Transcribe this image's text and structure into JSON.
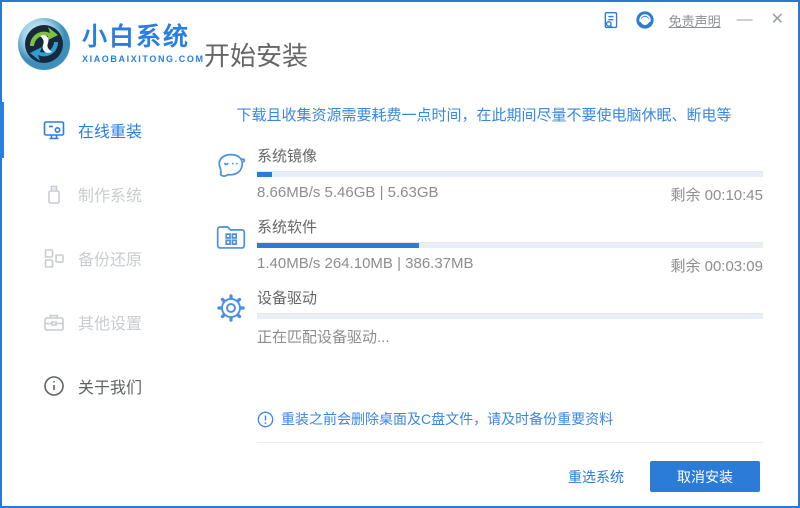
{
  "colors": {
    "accent": "#2a7cd8",
    "progress_fill": "#2b7bd7",
    "warning_text": "#3a87e2"
  },
  "titlebar": {
    "brand_title": "小白系统",
    "brand_subtitle": "XIAOBAIXITONG.COM",
    "page_title": "开始安装",
    "icons": [
      "log-document-icon",
      "customer-service-icon"
    ],
    "disclaimer_link": "免责声明",
    "minimize_glyph": "—",
    "close_glyph": "✕"
  },
  "sidebar": {
    "items": [
      {
        "label": "在线重装",
        "icon": "monitor-reinstall-icon",
        "state": "active"
      },
      {
        "label": "制作系统",
        "icon": "usb-drive-icon",
        "state": "disabled"
      },
      {
        "label": "备份还原",
        "icon": "backup-blocks-icon",
        "state": "disabled"
      },
      {
        "label": "其他设置",
        "icon": "toolbox-icon",
        "state": "disabled"
      },
      {
        "label": "关于我们",
        "icon": "info-circle-icon",
        "state": "normal"
      }
    ]
  },
  "main": {
    "warning": "下载且收集资源需要耗费一点时间，在此期间尽量不要使电脑休眠、断电等",
    "tasks": [
      {
        "name": "系统镜像",
        "icon": "mascot-face-icon",
        "progress_percent": 3,
        "stats": "8.66MB/s 5.46GB | 5.63GB",
        "remaining": "剩余 00:10:45"
      },
      {
        "name": "系统软件",
        "icon": "software-folder-icon",
        "progress_percent": 32,
        "stats": "1.40MB/s 264.10MB | 386.37MB",
        "remaining": "剩余 00:03:09"
      },
      {
        "name": "设备驱动",
        "icon": "gear-icon",
        "progress_percent": 0,
        "status": "正在匹配设备驱动..."
      }
    ],
    "notice": "重装之前会删除桌面及C盘文件，请及时备份重要资料"
  },
  "footer": {
    "reselect_label": "重选系统",
    "cancel_label": "取消安装"
  }
}
